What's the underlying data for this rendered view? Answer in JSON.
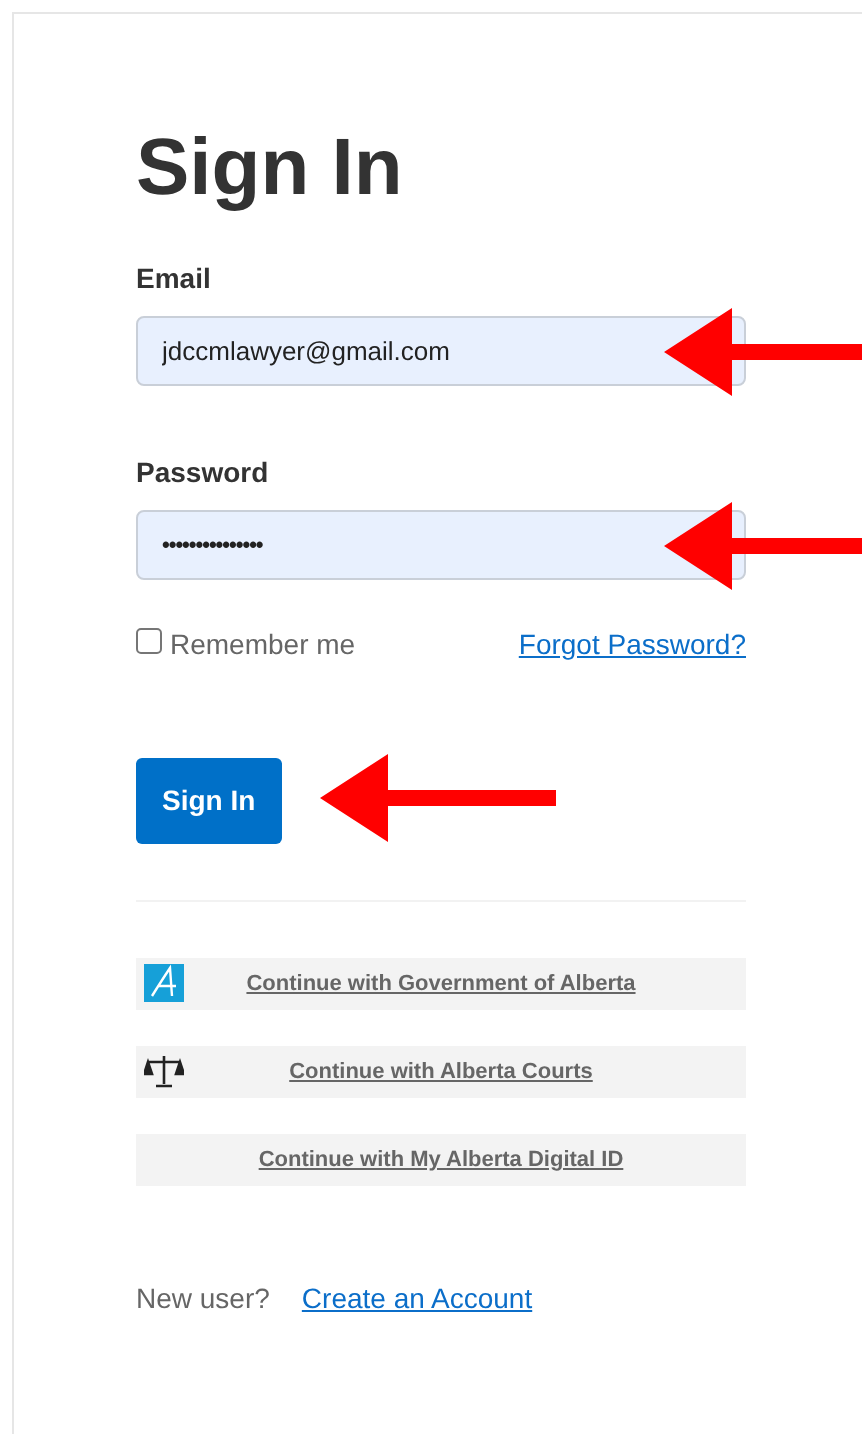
{
  "title": "Sign In",
  "fields": [
    {
      "label": "Email",
      "value": "jdccmlawyer@gmail.com",
      "kind": "email",
      "arrow": true
    },
    {
      "label": "Password",
      "value": "•••••••••••••••",
      "kind": "password",
      "arrow": true
    }
  ],
  "remember": {
    "label": "Remember me",
    "checked": false
  },
  "forgot_link": "Forgot Password?",
  "submit": {
    "label": "Sign In",
    "arrow": true
  },
  "providers": [
    {
      "label": "Continue with Government of Alberta",
      "kind": "gov"
    },
    {
      "label": "Continue with Alberta Courts",
      "kind": "courts"
    },
    {
      "label": "Continue with My Alberta Digital ID",
      "kind": "none"
    }
  ],
  "footer": {
    "text": "New user?",
    "link": "Create an Account"
  }
}
